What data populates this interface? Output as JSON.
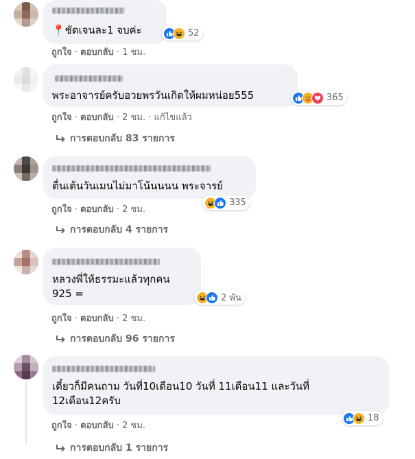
{
  "comments": [
    {
      "text": "📍ชัดเจนละ1 จบค่ะ",
      "reactions": [
        "like",
        "haha"
      ],
      "reaction_count": "52",
      "like_label": "ถูกใจ",
      "reply_label": "ตอบกลับ",
      "time": "1 ชม."
    },
    {
      "text": "พระอาจารย์ครับอวยพรวันเกิดให้ผมหน่อย555",
      "reactions": [
        "like",
        "care",
        "love"
      ],
      "reaction_count": "365",
      "like_label": "ถูกใจ",
      "reply_label": "ตอบกลับ",
      "time": "2 ชม.",
      "edited": "แก้ไขแล้ว",
      "replies": "การตอบกลับ 83 รายการ"
    },
    {
      "text": "ตื่นเต้นวันเมนไม่มาโน้นนนน พระจารย์",
      "reactions": [
        "haha",
        "like"
      ],
      "reaction_count": "335",
      "like_label": "ถูกใจ",
      "reply_label": "ตอบกลับ",
      "time": "2 ชม.",
      "replies": "การตอบกลับ 4 รายการ"
    },
    {
      "text": "หลวงพี่ให้ธรรมะแล้วทุกคน\n925 =",
      "reactions": [
        "haha",
        "like"
      ],
      "reaction_count": "2 พัน",
      "like_label": "ถูกใจ",
      "reply_label": "ตอบกลับ",
      "time": "2 ชม.",
      "replies": "การตอบกลับ 96 รายการ"
    },
    {
      "text": "เดี๋ยวก็มีคนถาม วันที่10เดือน10 วันที่ 11เดือน11 และวันที่\n12เดือน12ครับ",
      "reactions": [
        "like",
        "haha"
      ],
      "reaction_count": "18",
      "like_label": "ถูกใจ",
      "reply_label": "ตอบกลับ",
      "time": "2 ชม.",
      "replies": "การตอบกลับ 1 รายการ"
    }
  ],
  "colors": {
    "bubble": "#f0f2f5",
    "meta_text": "#65676b",
    "like_blue": "#1877f2",
    "haha_yellow": "#f7b125",
    "love_red": "#f33e58"
  },
  "separator": "·"
}
